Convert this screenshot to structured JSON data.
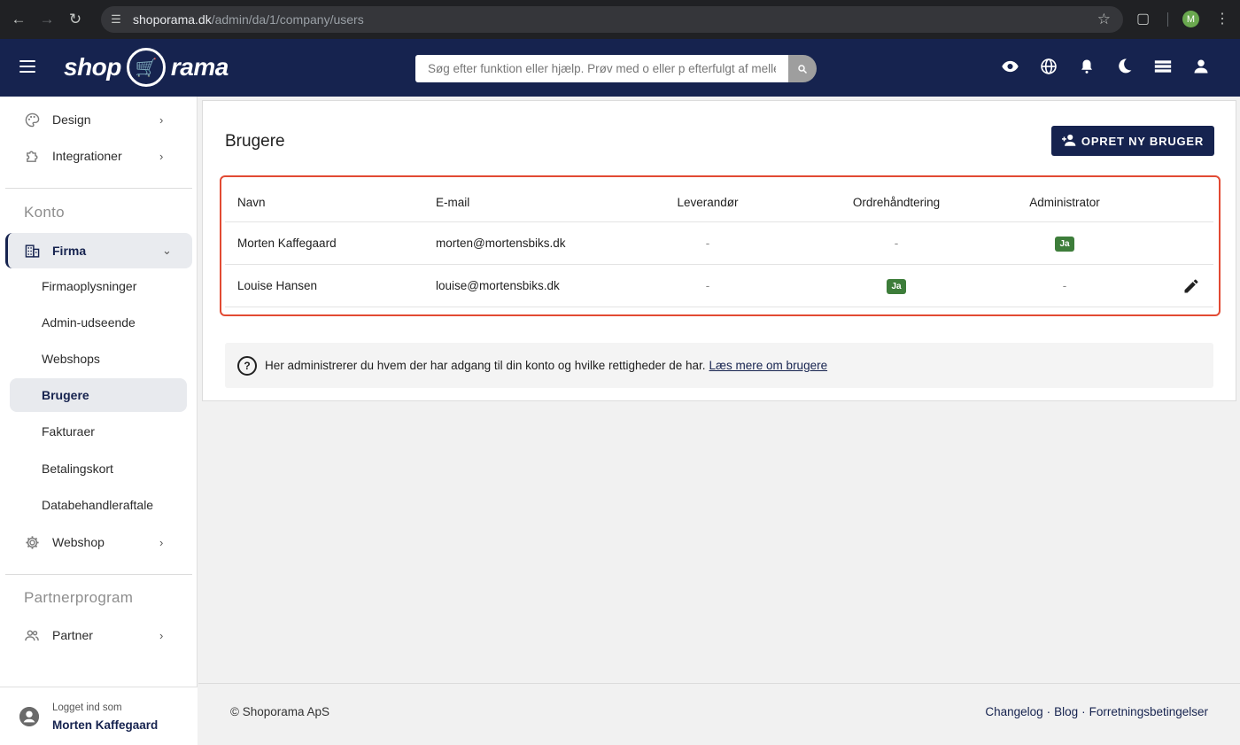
{
  "browser": {
    "url_host": "shoporama.dk",
    "url_path": "/admin/da/1/company/users",
    "profile_initial": "M"
  },
  "header": {
    "logo_left": "shop",
    "logo_right": "rama",
    "search_placeholder": "Søg efter funktion eller hjælp. Prøv med o eller p efterfulgt af mellemrum",
    "icons": [
      "eye-icon",
      "globe-icon",
      "bell-icon",
      "moon-icon",
      "menu-stack-icon",
      "person-icon"
    ]
  },
  "sidebar": {
    "top_items": [
      {
        "label": "Design",
        "icon": "palette-icon"
      },
      {
        "label": "Integrationer",
        "icon": "puzzle-icon"
      }
    ],
    "section_konto": "Konto",
    "firma": {
      "label": "Firma",
      "icon": "building-icon"
    },
    "sub_items": [
      {
        "label": "Firmaoplysninger"
      },
      {
        "label": "Admin-udseende"
      },
      {
        "label": "Webshops"
      },
      {
        "label": "Brugere"
      },
      {
        "label": "Fakturaer"
      },
      {
        "label": "Betalingskort"
      },
      {
        "label": "Databehandleraftale"
      }
    ],
    "webshop": {
      "label": "Webshop",
      "icon": "gear-icon"
    },
    "section_partner": "Partnerprogram",
    "partner": {
      "label": "Partner",
      "icon": "people-icon"
    },
    "footer": {
      "logged_in_label": "Logget ind som",
      "user_name": "Morten Kaffegaard"
    }
  },
  "main": {
    "title": "Brugere",
    "create_button": "OPRET NY BRUGER",
    "columns": {
      "navn": "Navn",
      "email": "E-mail",
      "leverandor": "Leverandør",
      "ordre": "Ordrehåndtering",
      "admin": "Administrator"
    },
    "rows": [
      {
        "navn": "Morten Kaffegaard",
        "email": "morten@mortensbiks.dk",
        "leverandor": "-",
        "ordre": "-",
        "admin": "Ja"
      },
      {
        "navn": "Louise Hansen",
        "email": "louise@mortensbiks.dk",
        "leverandor": "-",
        "ordre": "Ja",
        "admin": "-"
      }
    ],
    "info_text": "Her administrerer du hvem der har adgang til din konto og hvilke rettigheder de har.",
    "info_link": "Læs mere om brugere"
  },
  "footer": {
    "copyright": "© Shoporama ApS",
    "links": [
      "Changelog",
      "Blog",
      "Forretningsbetingelser"
    ],
    "separator": "·"
  },
  "colors": {
    "brand_navy": "#16234f",
    "badge_green": "#3d7d3a",
    "highlight_red": "#e24a33"
  }
}
